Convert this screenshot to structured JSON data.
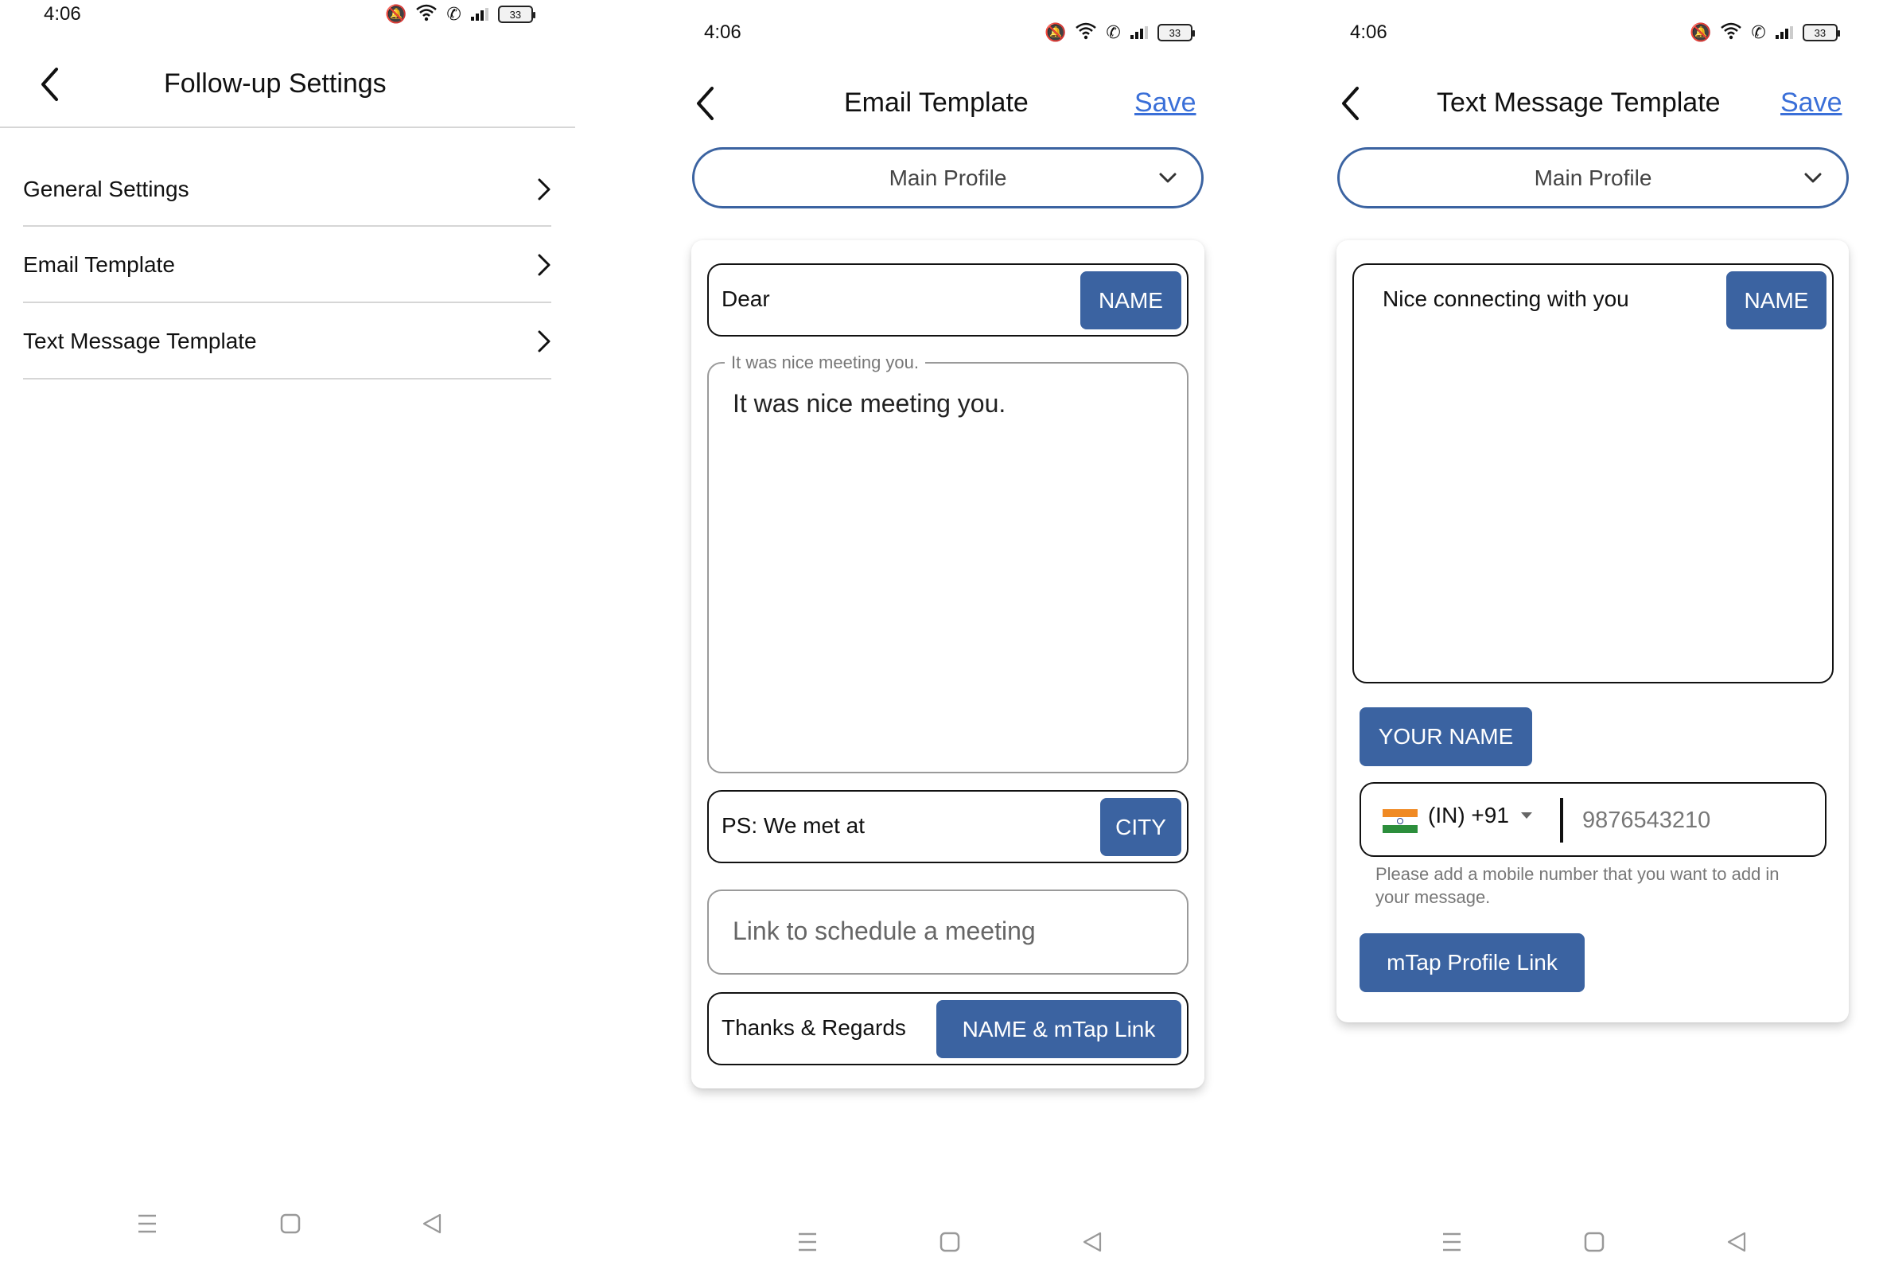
{
  "colors": {
    "accent": "#3b63a1",
    "link": "#3a6fd8",
    "divider": "#d6d6d6"
  },
  "status_bar": {
    "time": "4:06",
    "battery": "33",
    "icons": [
      "mute-icon",
      "wifi-icon",
      "wifi-calling-icon",
      "signal-icon",
      "battery-icon"
    ]
  },
  "screens": [
    {
      "title": "Follow-up Settings",
      "back_icon": "chevron-left-icon",
      "items": [
        {
          "label": "General Settings",
          "icon": "chevron-right-icon"
        },
        {
          "label": "Email Template",
          "icon": "chevron-right-icon"
        },
        {
          "label": "Text Message Template",
          "icon": "chevron-right-icon"
        }
      ]
    },
    {
      "title": "Email Template",
      "save_label": "Save",
      "profile_select": {
        "value": "Main Profile",
        "icon": "chevron-down-icon"
      },
      "greeting": {
        "text": "Dear",
        "chip": "NAME"
      },
      "body": {
        "legend": "It was nice meeting you.",
        "value": "It was nice meeting you."
      },
      "ps": {
        "text": "PS: We met at",
        "chip": "CITY"
      },
      "schedule_link": {
        "placeholder": "Link to schedule a meeting"
      },
      "signoff": {
        "text": "Thanks & Regards",
        "chip": "NAME & mTap Link"
      }
    },
    {
      "title": "Text Message Template",
      "save_label": "Save",
      "profile_select": {
        "value": "Main Profile",
        "icon": "chevron-down-icon"
      },
      "message": {
        "text": "Nice connecting with you",
        "chip": "NAME"
      },
      "your_name_chip": "YOUR NAME",
      "phone": {
        "country": "(IN) +91",
        "flag": "india-flag-icon",
        "placeholder": "9876543210"
      },
      "helper": "Please add a mobile number that you want to add in your message.",
      "profile_link_chip": "mTap Profile Link"
    }
  ],
  "nav_bar": [
    "menu-icon",
    "home-icon",
    "back-icon"
  ]
}
